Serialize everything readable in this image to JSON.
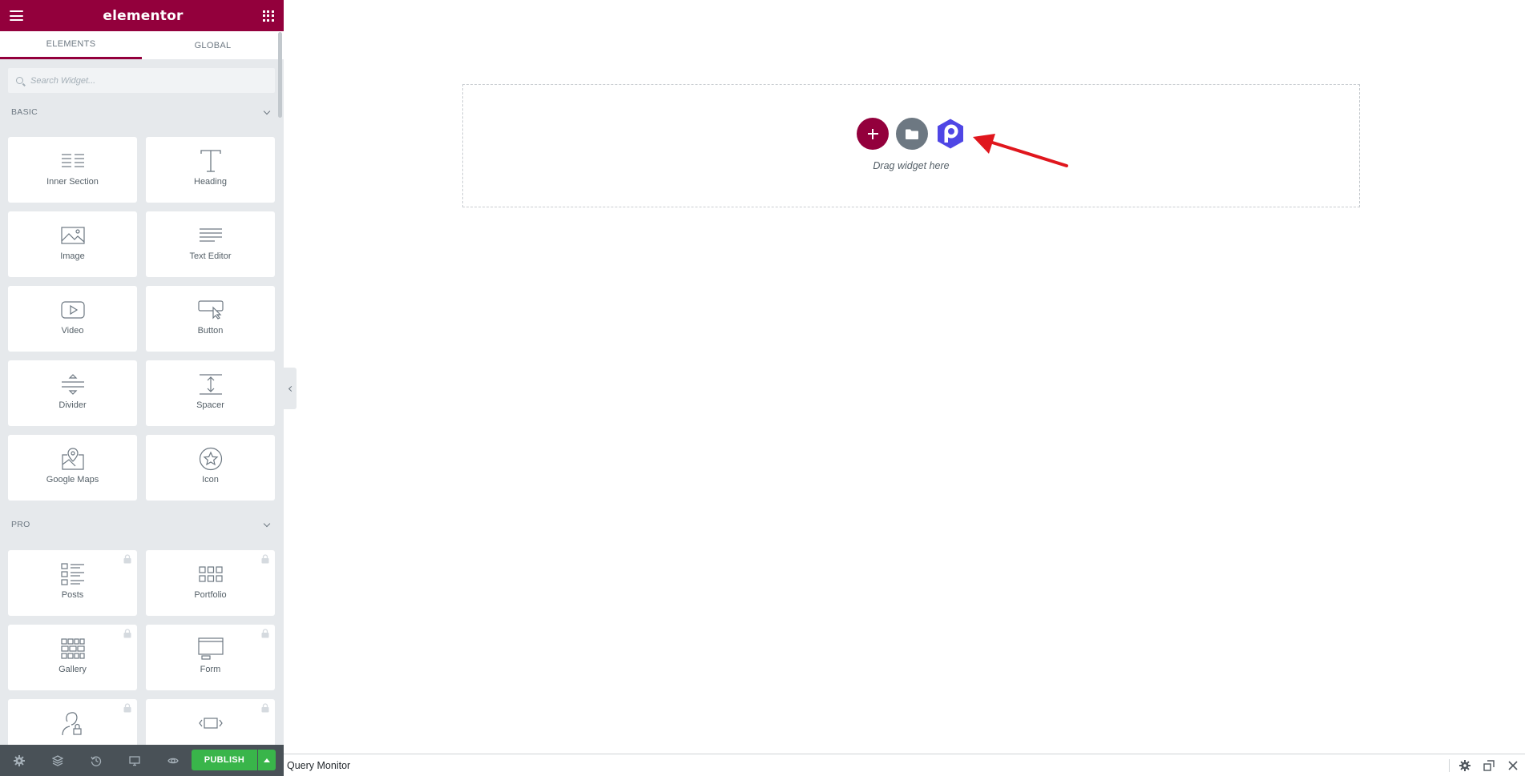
{
  "panel": {
    "logo": "elementor",
    "tabs": [
      {
        "label": "ELEMENTS",
        "active": true
      },
      {
        "label": "GLOBAL",
        "active": false
      }
    ],
    "search": {
      "placeholder": "Search Widget..."
    },
    "categories": [
      {
        "title": "BASIC",
        "widgets": [
          {
            "label": "Inner Section",
            "icon": "inner-section-icon"
          },
          {
            "label": "Heading",
            "icon": "heading-icon"
          },
          {
            "label": "Image",
            "icon": "image-icon"
          },
          {
            "label": "Text Editor",
            "icon": "text-editor-icon"
          },
          {
            "label": "Video",
            "icon": "video-icon"
          },
          {
            "label": "Button",
            "icon": "button-icon"
          },
          {
            "label": "Divider",
            "icon": "divider-icon"
          },
          {
            "label": "Spacer",
            "icon": "spacer-icon"
          },
          {
            "label": "Google Maps",
            "icon": "google-maps-icon"
          },
          {
            "label": "Icon",
            "icon": "star-icon"
          }
        ]
      },
      {
        "title": "PRO",
        "widgets": [
          {
            "label": "Posts",
            "icon": "posts-icon",
            "locked": true
          },
          {
            "label": "Portfolio",
            "icon": "portfolio-icon",
            "locked": true
          },
          {
            "label": "Gallery",
            "icon": "gallery-icon",
            "locked": true
          },
          {
            "label": "Form",
            "icon": "form-icon",
            "locked": true
          },
          {
            "label": "",
            "icon": "login-icon",
            "locked": true
          },
          {
            "label": "",
            "icon": "slides-icon",
            "locked": true
          }
        ]
      }
    ],
    "footer": {
      "publish_label": "PUBLISH",
      "icons": [
        "settings-icon",
        "navigator-icon",
        "history-icon",
        "responsive-mode-icon",
        "preview-icon"
      ]
    }
  },
  "canvas": {
    "drop_text": "Drag widget here",
    "colors": {
      "add": "#93003c",
      "template": "#6d7882",
      "plugin": "#4f46e5",
      "arrow": "#e0161d"
    }
  },
  "query_monitor": {
    "title": "Query Monitor",
    "controls": [
      "gear-icon",
      "popout-icon",
      "close-icon"
    ]
  },
  "colors": {
    "brand": "#93003c",
    "panel_bg": "#e6e9ec",
    "footer_bg": "#495157",
    "publish": "#39b54a"
  }
}
